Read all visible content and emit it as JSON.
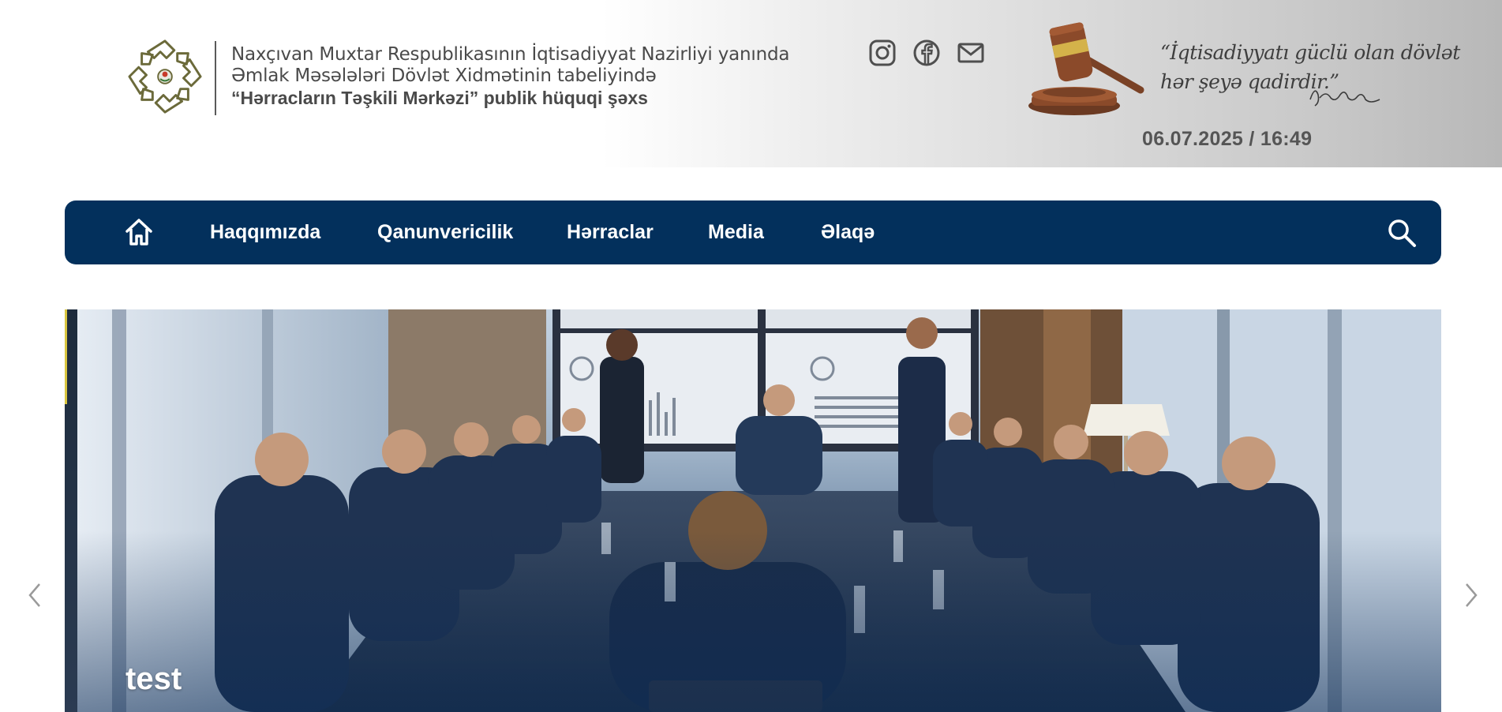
{
  "header": {
    "org_line1": "Naxçıvan Muxtar Respublikasının İqtisadiyyat Nazirliyi yanında",
    "org_line2": "Əmlak Məsələləri Dövlət Xidmətinin tabeliyində",
    "org_line3": "“Hərracların Təşkili Mərkəzi” publik hüquqi şəxs",
    "logo_icon": "emblem-logo-icon",
    "quote_line1": "“İqtisadiyyatı güclü olan dövlət",
    "quote_line2": "hər şeyə qadirdir.”",
    "datetime": "06.07.2025 / 16:49"
  },
  "social": [
    {
      "icon": "instagram-icon"
    },
    {
      "icon": "facebook-icon"
    },
    {
      "icon": "mail-icon"
    }
  ],
  "nav": {
    "home_icon": "home-icon",
    "items": [
      "Haqqımızda",
      "Qanunvericilik",
      "Hərraclar",
      "Media",
      "Əlaqə"
    ],
    "search_icon": "search-icon"
  },
  "slider": {
    "caption": "test",
    "prev_icon": "chevron-left-icon",
    "next_icon": "chevron-right-icon"
  },
  "colors": {
    "nav_bg": "#03305c",
    "text_gray": "#4a4a4a",
    "logo_olive": "#6b6a3a"
  }
}
